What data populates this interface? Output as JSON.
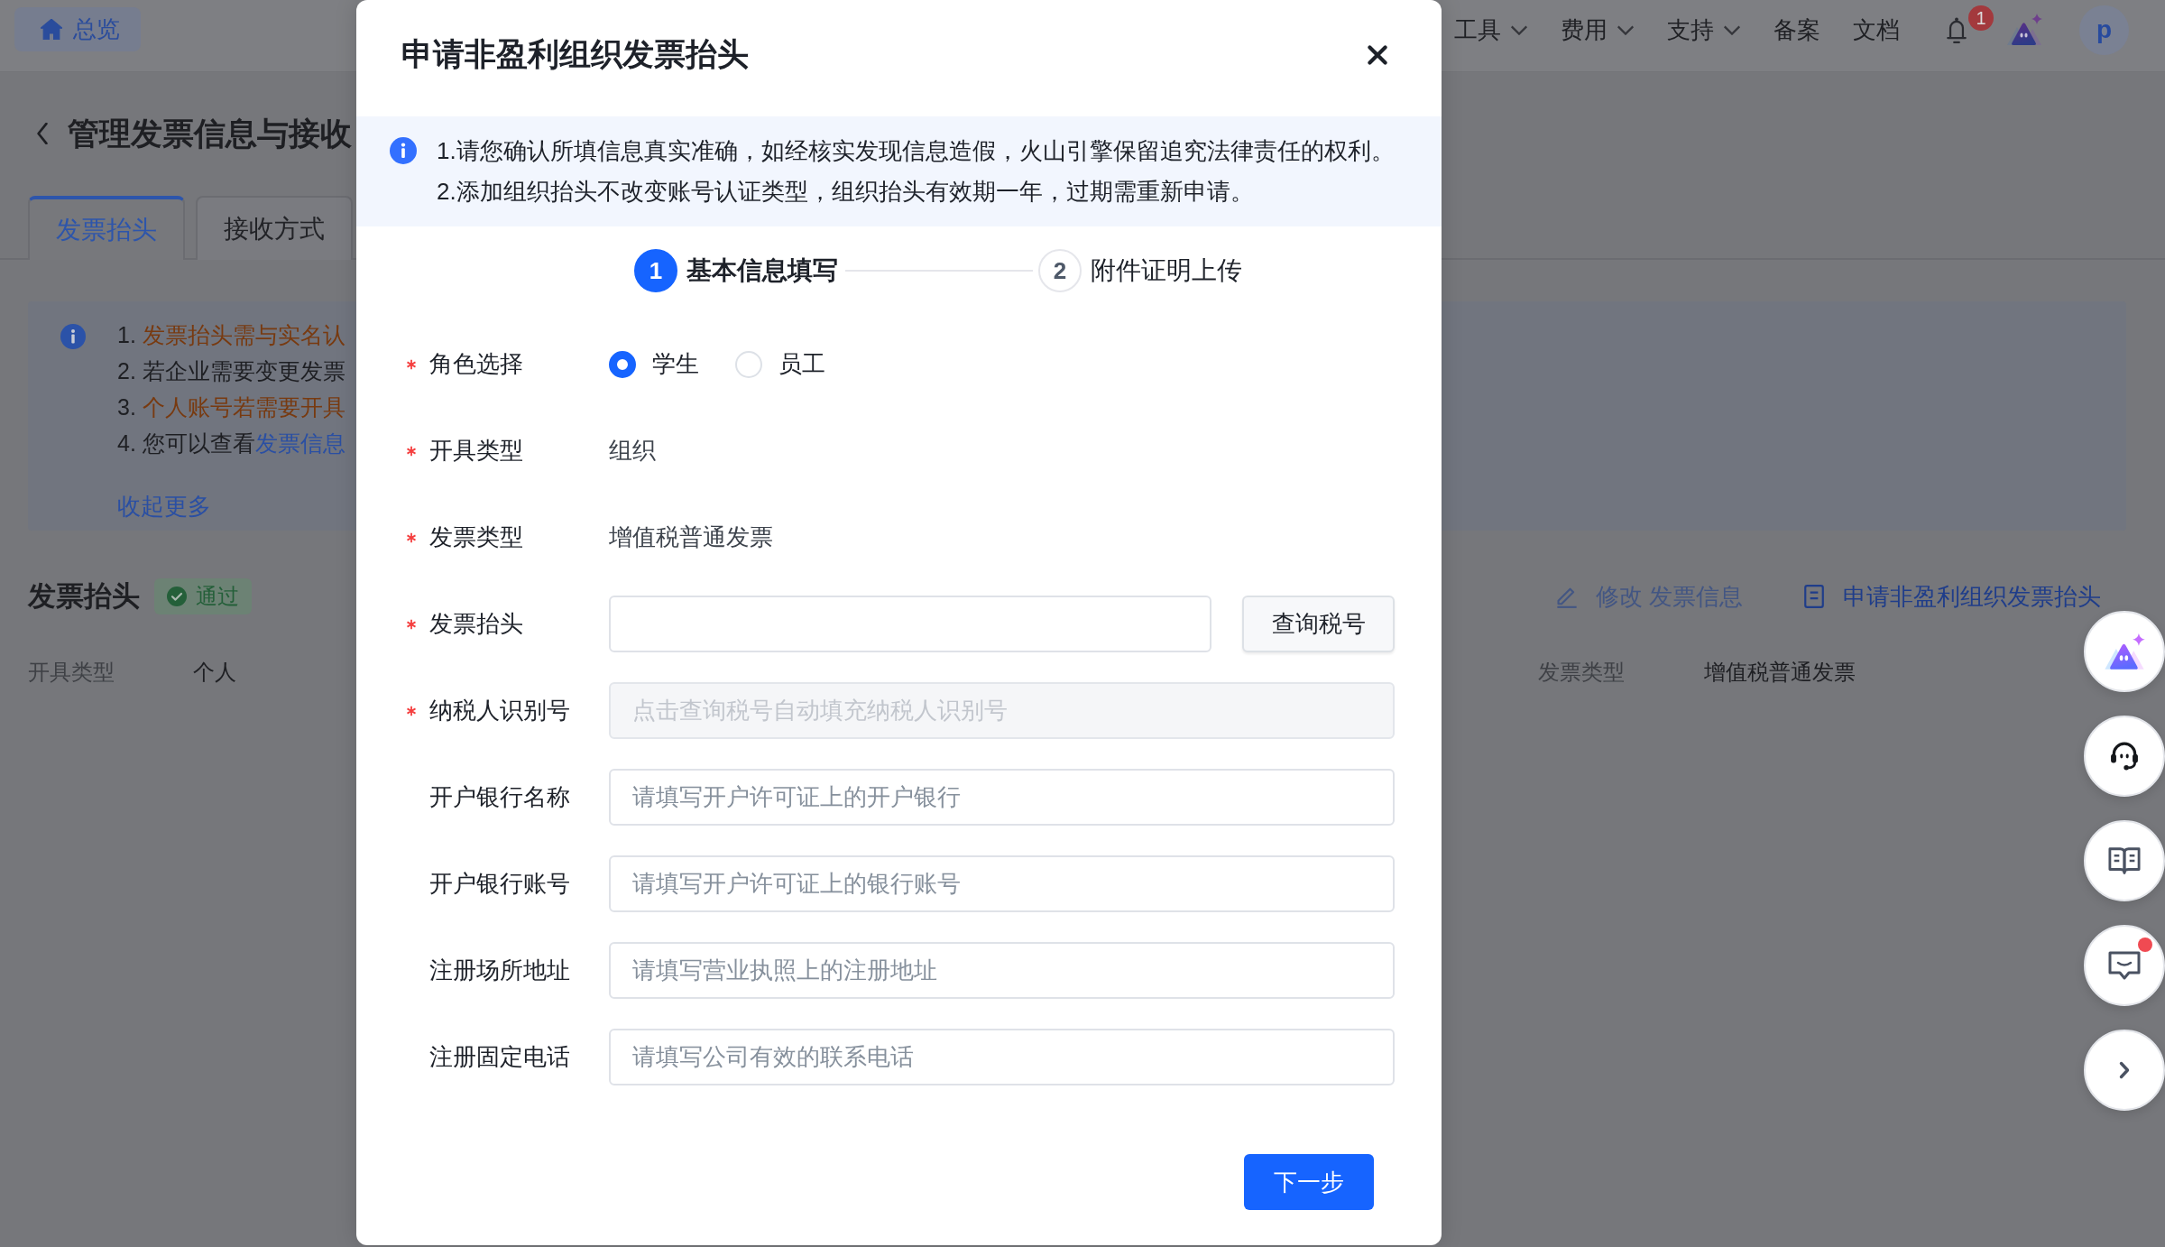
{
  "top_nav": {
    "home": {
      "label": "总览"
    },
    "menus": [
      {
        "label": "工具",
        "dropdown": true
      },
      {
        "label": "费用",
        "dropdown": true
      },
      {
        "label": "支持",
        "dropdown": true
      },
      {
        "label": "备案",
        "dropdown": false
      },
      {
        "label": "文档",
        "dropdown": false
      }
    ],
    "notifications": {
      "count": "1"
    },
    "avatar": {
      "initial": "p"
    }
  },
  "page": {
    "title": "管理发票信息与接收",
    "tabs": [
      {
        "label": "发票抬头",
        "selected": true
      },
      {
        "label": "接收方式",
        "selected": false
      }
    ],
    "notice": {
      "lines": [
        {
          "parts": [
            {
              "kind": "plain",
              "text": "1. "
            },
            {
              "kind": "highlight",
              "text": "发票抬头需与实名认"
            }
          ]
        },
        {
          "parts": [
            {
              "kind": "plain",
              "text": "2. 若企业需要变更发票"
            }
          ]
        },
        {
          "parts": [
            {
              "kind": "plain",
              "text": "3. "
            },
            {
              "kind": "highlight",
              "text": "个人账号若需要开具"
            }
          ]
        },
        {
          "parts": [
            {
              "kind": "plain",
              "text": "4. 您可以查看"
            },
            {
              "kind": "link",
              "text": "发票信息"
            }
          ]
        }
      ],
      "collapse_link": "收起更多"
    },
    "section": {
      "title": "发票抬头",
      "status": {
        "kind": "success",
        "label": "通过"
      },
      "actions": [
        {
          "kind": "edit",
          "label": "修改 发票信息",
          "disabled": true
        },
        {
          "kind": "apply",
          "label": "申请非盈利组织发票抬头",
          "disabled": false
        }
      ],
      "details": [
        {
          "label": "开具类型",
          "value": "个人"
        },
        {
          "label": "发票类型",
          "value": "增值税普通发票"
        }
      ]
    }
  },
  "dialog": {
    "title": "申请非盈利组织发票抬头",
    "notice": [
      "1.请您确认所填信息真实准确，如经核实发现信息造假，火山引擎保留追究法律责任的权利。",
      "2.添加组织抬头不改变账号认证类型，组织抬头有效期一年，过期需重新申请。"
    ],
    "steps": [
      {
        "number": "1",
        "label": "基本信息填写",
        "current": true
      },
      {
        "number": "2",
        "label": "附件证明上传",
        "current": false
      }
    ],
    "fields": [
      {
        "kind": "radio",
        "label": "角色选择",
        "required": true,
        "options": [
          {
            "label": "学生",
            "selected": true
          },
          {
            "label": "员工",
            "selected": false
          }
        ]
      },
      {
        "kind": "static",
        "label": "开具类型",
        "required": true,
        "value": "组织"
      },
      {
        "kind": "static",
        "label": "发票类型",
        "required": true,
        "value": "增值税普通发票"
      },
      {
        "kind": "input_button",
        "label": "发票抬头",
        "required": true,
        "button": "查询税号"
      },
      {
        "kind": "input",
        "label": "纳税人识别号",
        "required": true,
        "placeholder": "点击查询税号自动填充纳税人识别号",
        "disabled": true
      },
      {
        "kind": "input",
        "label": "开户银行名称",
        "required": false,
        "placeholder": "请填写开户许可证上的开户银行",
        "disabled": false
      },
      {
        "kind": "input",
        "label": "开户银行账号",
        "required": false,
        "placeholder": "请填写开户许可证上的银行账号",
        "disabled": false
      },
      {
        "kind": "input",
        "label": "注册场所地址",
        "required": false,
        "placeholder": "请填写营业执照上的注册地址",
        "disabled": false
      },
      {
        "kind": "input",
        "label": "注册固定电话",
        "required": false,
        "placeholder": "请填写公司有效的联系电话",
        "disabled": false
      }
    ],
    "next_button": "下一步"
  },
  "side_toolbar": {
    "feedback": {
      "unread": true
    }
  }
}
